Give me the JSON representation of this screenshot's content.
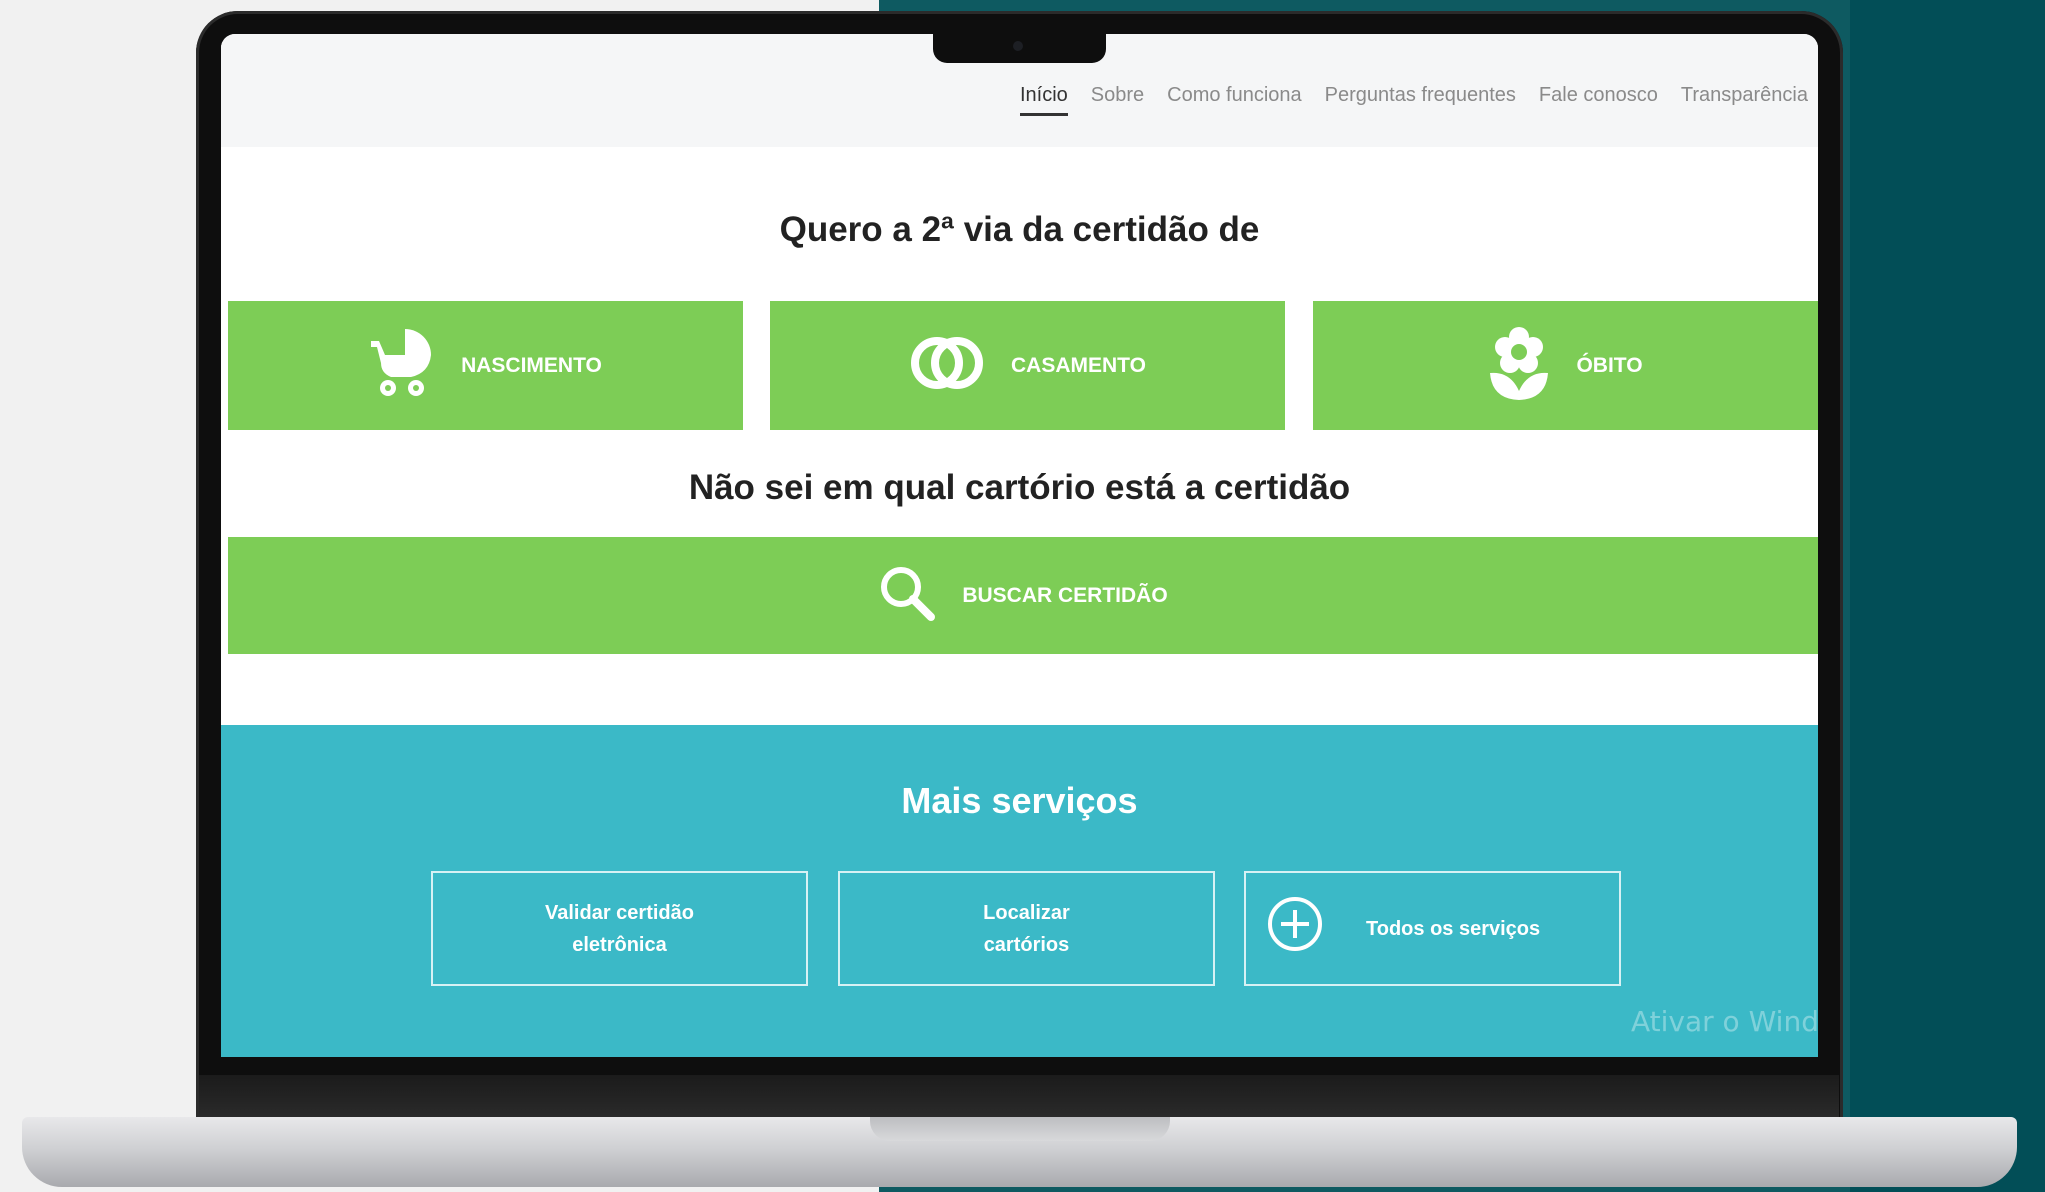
{
  "nav": {
    "items": [
      {
        "label": "Início",
        "active": true
      },
      {
        "label": "Sobre",
        "active": false
      },
      {
        "label": "Como funciona",
        "active": false
      },
      {
        "label": "Perguntas frequentes",
        "active": false
      },
      {
        "label": "Fale conosco",
        "active": false
      },
      {
        "label": "Transparência",
        "active": false
      }
    ]
  },
  "certificates": {
    "heading": "Quero a 2ª via da certidão de",
    "tiles": [
      {
        "label": "NASCIMENTO",
        "icon": "baby-stroller-icon"
      },
      {
        "label": "CASAMENTO",
        "icon": "wedding-rings-icon"
      },
      {
        "label": "ÓBITO",
        "icon": "flower-icon"
      }
    ]
  },
  "search": {
    "heading": "Não sei em qual cartório está a certidão",
    "button_label": "BUSCAR CERTIDÃO",
    "icon": "search-icon"
  },
  "services": {
    "title": "Mais serviços",
    "items": [
      {
        "line1": "Validar certidão",
        "line2": "eletrônica"
      },
      {
        "line1": "Localizar",
        "line2": "cartórios"
      },
      {
        "label": "Todos os serviços",
        "icon": "plus-circle-icon"
      }
    ]
  },
  "watermark": "Ativar o Windo",
  "colors": {
    "green": "#7dcd56",
    "teal": "#3bb9c7",
    "background_dark": "#0e5a61"
  }
}
